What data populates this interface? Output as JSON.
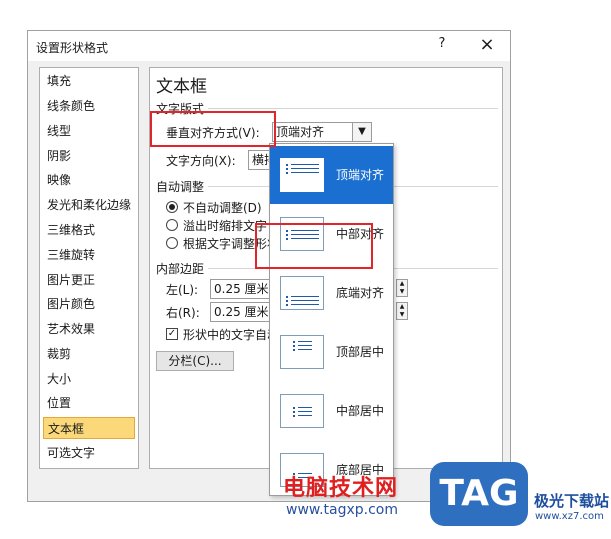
{
  "dialog": {
    "title": "设置形状格式",
    "help": "?",
    "close": "×"
  },
  "categories": [
    "填充",
    "线条颜色",
    "线型",
    "阴影",
    "映像",
    "发光和柔化边缘",
    "三维格式",
    "三维旋转",
    "图片更正",
    "图片颜色",
    "艺术效果",
    "裁剪",
    "大小",
    "位置",
    "文本框",
    "可选文字"
  ],
  "selected_category": "文本框",
  "panel": {
    "title": "文本框",
    "layout_section": "文字版式",
    "vertical_align_label": "垂直对齐方式(V):",
    "vertical_align_value": "顶端对齐",
    "text_direction_label": "文字方向(X):",
    "text_direction_value": "横排",
    "autofit_section": "自动调整",
    "autofit_options": [
      "不自动调整(D)",
      "溢出时缩排文字",
      "根据文字调整形状"
    ],
    "margins_section": "内部边距",
    "left_label": "左(L):",
    "left_value": "0.25 厘米",
    "right_label": "右(R):",
    "right_value": "0.25 厘米",
    "wrap_checkbox": "形状中的文字自动",
    "columns_button": "分栏(C)..."
  },
  "dropdown_options": [
    "顶端对齐",
    "中部对齐",
    "底端对齐",
    "顶部居中",
    "中部居中",
    "底部居中"
  ],
  "watermark": {
    "site_name": "电脑技术网",
    "site_url": "www.tagxp.com",
    "logo_text": "TAG",
    "brand": "极光下载站",
    "brand_url": "www.xz7.com"
  },
  "colors": {
    "highlight_box": "#e0262a",
    "selected_option": "#1a6fd1",
    "selected_category": "#fbd97a"
  }
}
